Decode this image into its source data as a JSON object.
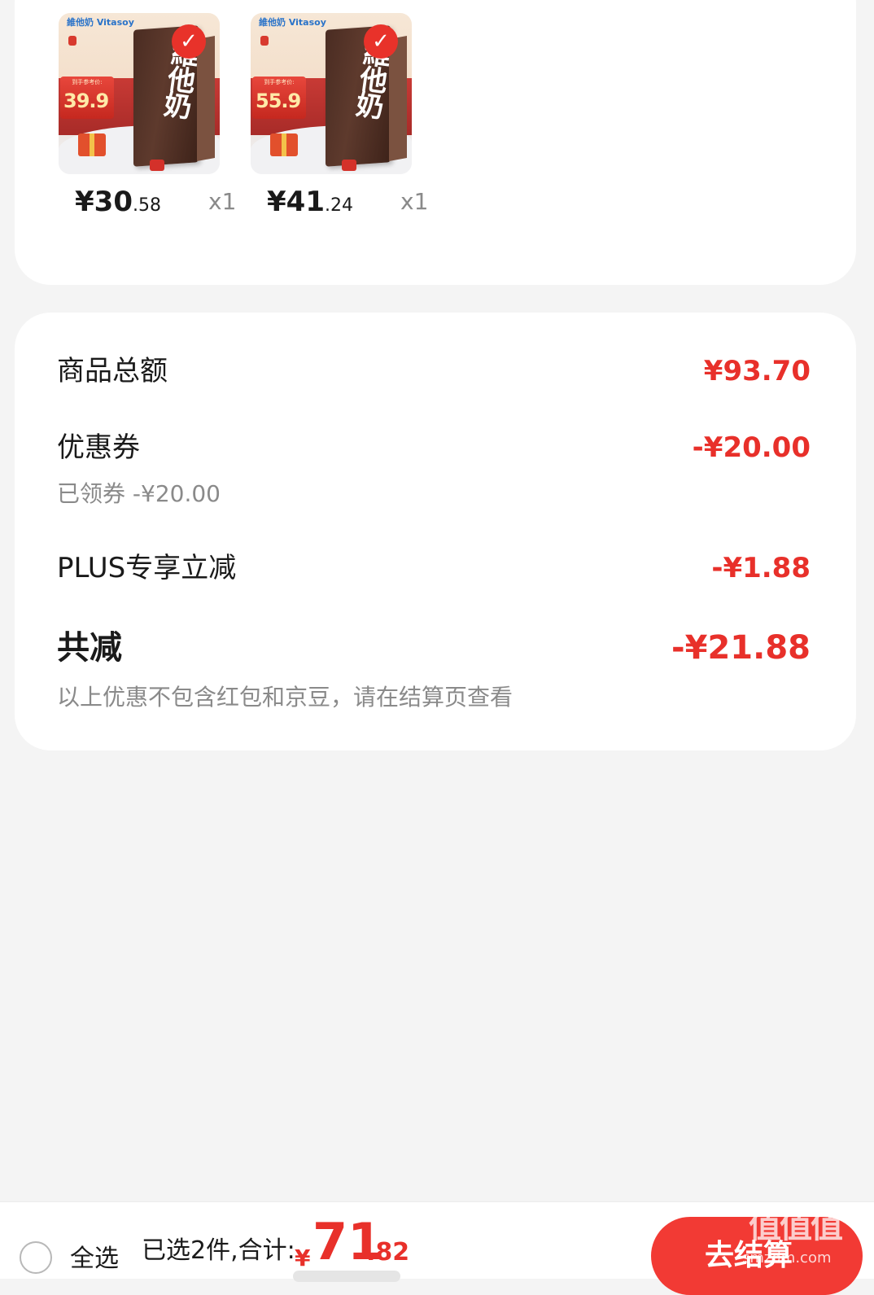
{
  "products": [
    {
      "brand": "維他奶 Vitasoy",
      "box_title": "維他奶",
      "tag_label": "到手参考价:",
      "tag_price": "39.9",
      "price_main": "¥30",
      "price_cents": ".58",
      "qty": "x1"
    },
    {
      "brand": "維他奶 Vitasoy",
      "box_title": "維他奶",
      "tag_label": "到手参考价:",
      "tag_price": "55.9",
      "price_main": "¥41",
      "price_cents": ".24",
      "qty": "x1"
    }
  ],
  "summary": {
    "goods_total_label": "商品总额",
    "goods_total_value": "¥93.70",
    "coupon_label": "优惠券",
    "coupon_value": "-¥20.00",
    "coupon_sub": "已领券 -¥20.00",
    "plus_label": "PLUS专享立减",
    "plus_value": "-¥1.88",
    "total_reduce_label": "共减",
    "total_reduce_value": "-¥21.88",
    "note": "以上优惠不包含红包和京豆，请在结算页查看"
  },
  "bottom_bar": {
    "select_all": "全选",
    "selected_info": "已选2件,合计:",
    "currency": "¥",
    "total_int": "71",
    "total_dec": ".82",
    "checkout": "去结算",
    "watermark": "值值值",
    "watermark_sub": "smzdm.com"
  },
  "colors": {
    "accent": "#e8302a",
    "background": "#f4f4f4",
    "card": "#ffffff",
    "muted_text": "#8a8a8a"
  },
  "icons": {
    "product_selected": "check-icon",
    "select_all": "radio-unchecked-icon"
  }
}
